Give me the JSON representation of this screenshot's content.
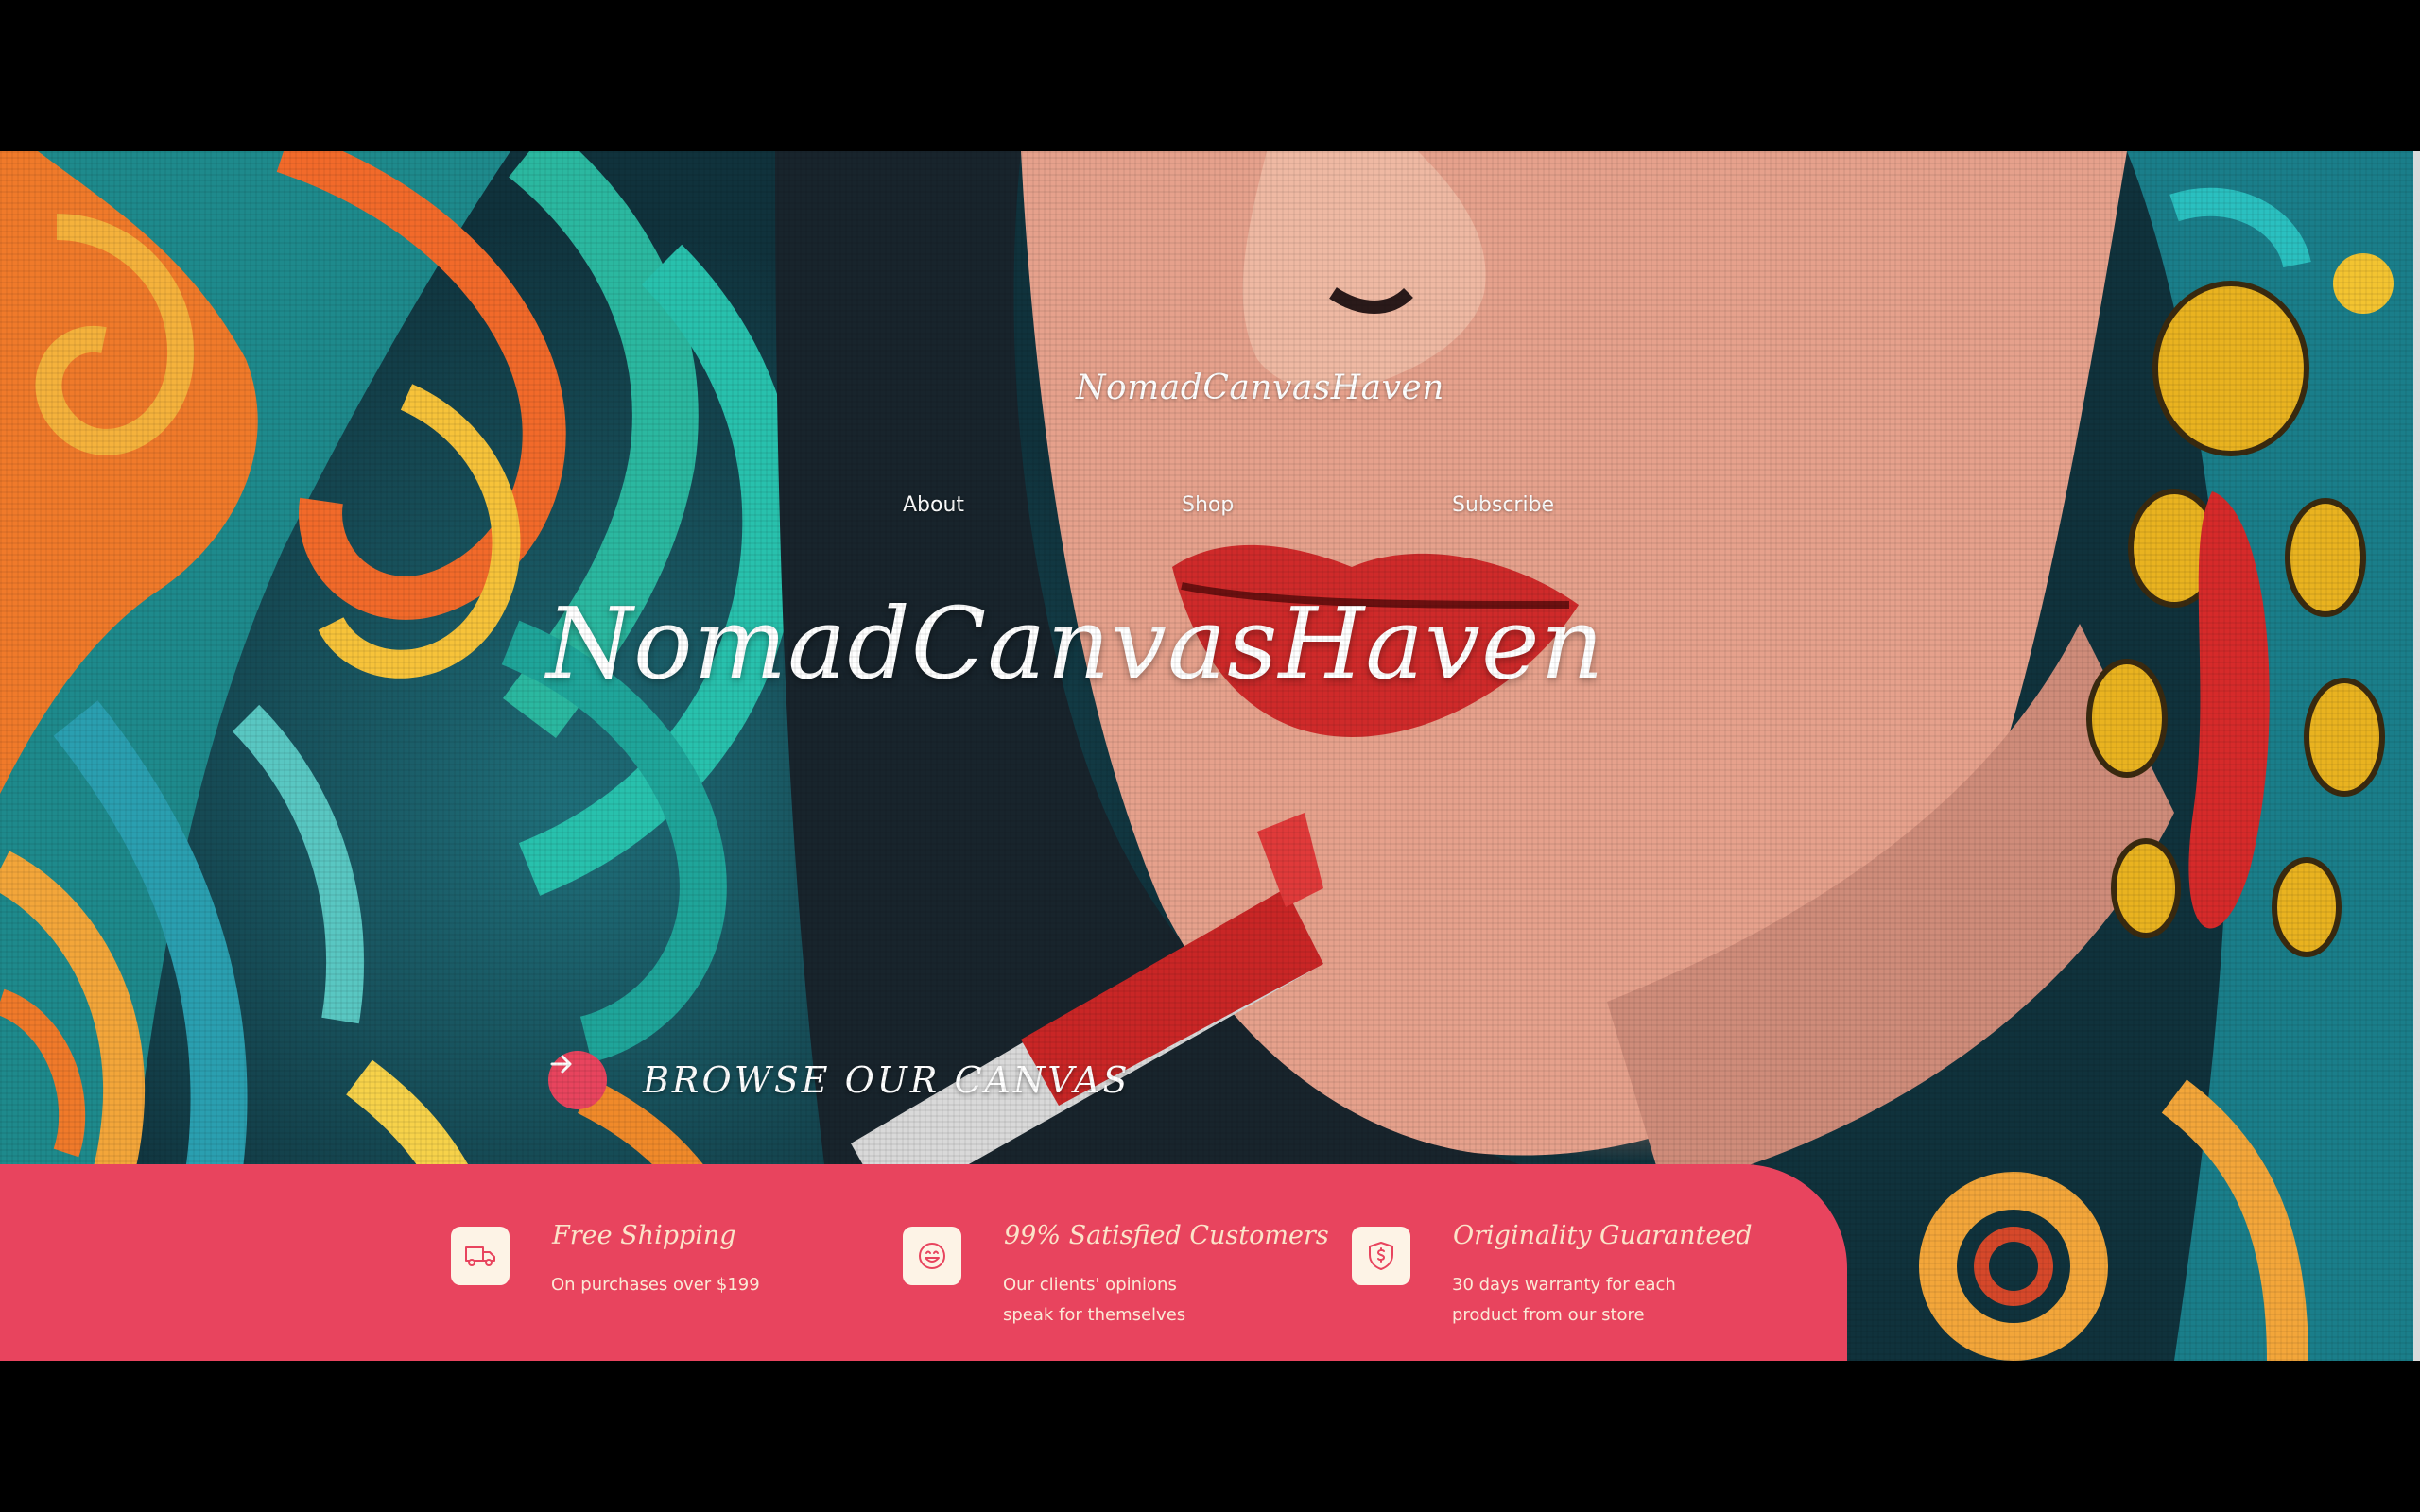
{
  "header": {
    "brand": "NomadCanvasHaven",
    "nav": [
      {
        "label": "About"
      },
      {
        "label": "Shop"
      },
      {
        "label": "Subscribe"
      }
    ]
  },
  "hero": {
    "title": "NomadCanvasHaven",
    "cta_label": "BROWSE OUR CANVAS",
    "cta_icon": "arrow-right-icon"
  },
  "features": [
    {
      "icon": "truck-icon",
      "title": "Free Shipping",
      "desc_line1": "On purchases over $199",
      "desc_line2": ""
    },
    {
      "icon": "smile-icon",
      "title": "99% Satisfied Customers",
      "desc_line1": "Our clients' opinions",
      "desc_line2": "speak for themselves"
    },
    {
      "icon": "shield-dollar-icon",
      "title": "Originality Guaranteed",
      "desc_line1": "30 days warranty for each",
      "desc_line2": "product from our store"
    }
  ],
  "colors": {
    "accent": "#e8445e",
    "feature_text": "#fbe3c9",
    "icon_box": "#fdf3e6",
    "background": "#000000"
  }
}
